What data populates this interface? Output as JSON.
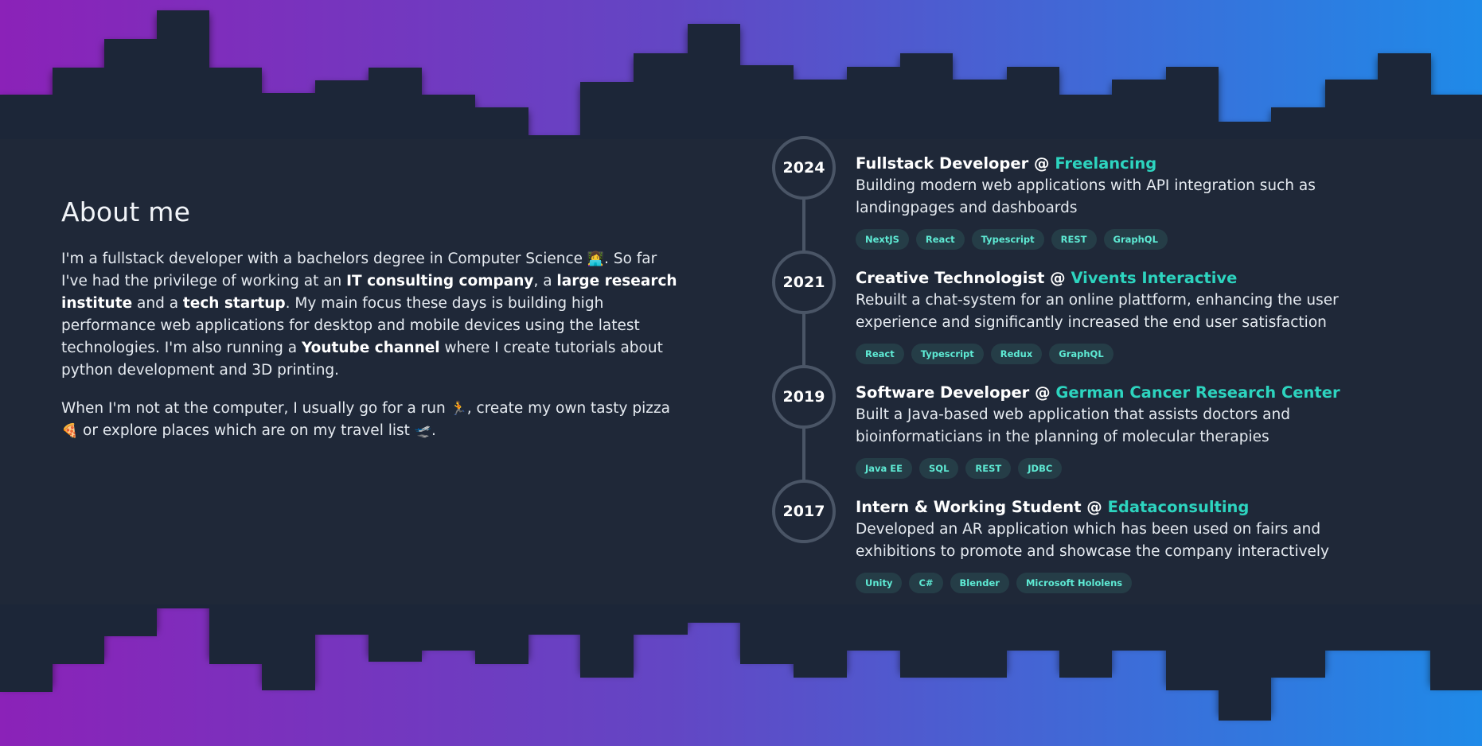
{
  "theme": {
    "background": "#1f2838",
    "gradient_start": "#8b22b8",
    "gradient_mid": "#5b4cc4",
    "gradient_end": "#1f8ae8",
    "accent": "#2dd4bf",
    "tag_text": "#5eead4"
  },
  "about": {
    "title": "About me",
    "p1": {
      "t1": "I'm a fullstack developer with a bachelors degree in Computer Science ",
      "emoji1": "👩‍💻",
      "t2": ". So far I've had the privilege of working at an ",
      "b1": "IT consulting company",
      "t3": ", a ",
      "b2": "large research institute",
      "t4": " and a ",
      "b3": "tech startup",
      "t5": ". My main focus these days is building high performance web applications for desktop and mobile devices using the latest technologies. I'm also running a ",
      "b4": "Youtube channel",
      "t6": " where I create tutorials about python development and 3D printing."
    },
    "p2": {
      "t1": "When I'm not at the computer, I usually go for a run ",
      "emoji_run": "🏃",
      "t2": ", create my own tasty pizza ",
      "emoji_pizza": "🍕",
      "t3": " or explore places which are on my travel list ",
      "emoji_plane": "🛫",
      "t4": "."
    }
  },
  "timeline": {
    "entries": [
      {
        "year": "2024",
        "role": "Fullstack Developer @ ",
        "company": "Freelancing",
        "description": "Building modern web applications with API integration such as landingpages and dashboards",
        "tags": [
          "NextJS",
          "React",
          "Typescript",
          "REST",
          "GraphQL"
        ]
      },
      {
        "year": "2021",
        "role": "Creative Technologist @ ",
        "company": "Vivents Interactive",
        "description": "Rebuilt a chat-system for an online plattform, enhancing the user experience and significantly increased the end user satisfaction",
        "tags": [
          "React",
          "Typescript",
          "Redux",
          "GraphQL"
        ]
      },
      {
        "year": "2019",
        "role": "Software Developer @ ",
        "company": "German Cancer Research Center",
        "description": "Built a Java-based web application that assists doctors and bioinformaticians in the planning of molecular therapies",
        "tags": [
          "Java EE",
          "SQL",
          "REST",
          "JDBC"
        ]
      },
      {
        "year": "2017",
        "role": "Intern & Working Student @ ",
        "company": "Edataconsulting",
        "description": "Developed an AR application which has been used on fairs and exhibitions to promote and showcase the company interactively",
        "tags": [
          "Unity",
          "C#",
          "Blender",
          "Microsoft Hololens"
        ]
      }
    ]
  }
}
